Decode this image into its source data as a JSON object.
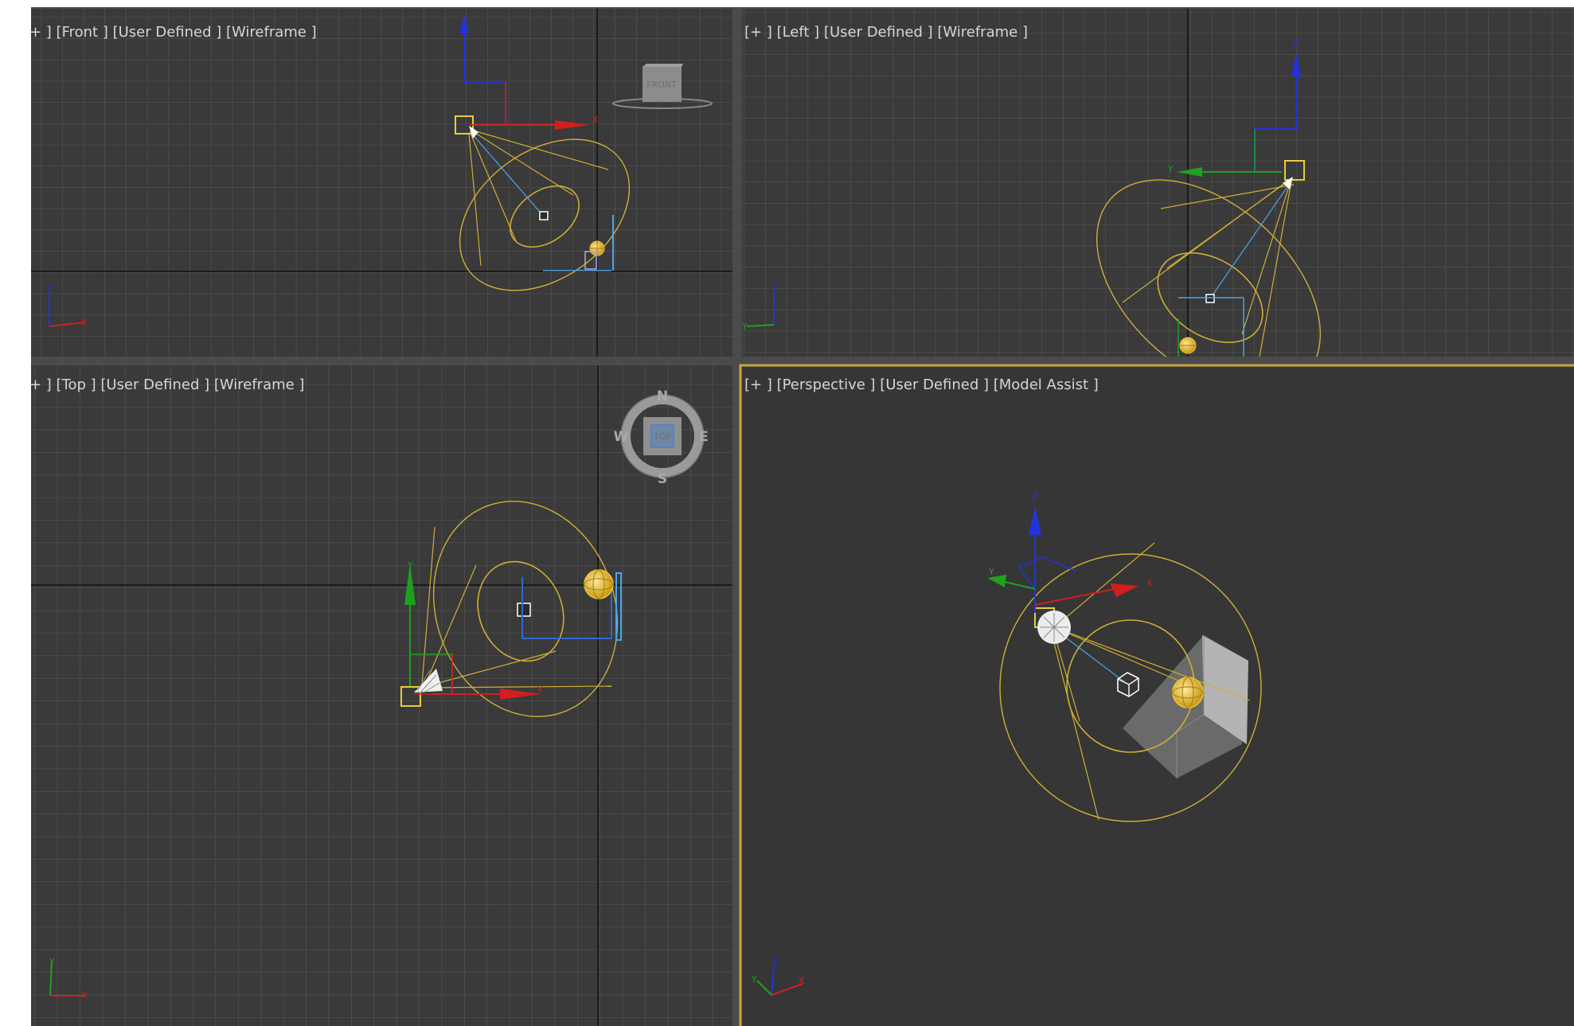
{
  "colors": {
    "viewport_bg": "#3a3a3a",
    "perspective_bg": "#363636",
    "grid": "#5a5a5a",
    "grid_major": "#111111",
    "divider": "#4b4b4b",
    "active_border": "#c7a640",
    "light": "#cfae36",
    "axis_x": "#d21e1e",
    "axis_y": "#1fa01f",
    "axis_z": "#2233dd",
    "target": "#ffffff",
    "target_line": "#4aa6e8",
    "wall": "#c8c8c8"
  },
  "viewports": {
    "front": {
      "label": "+ ] [Front ] [User Defined ] [Wireframe ]",
      "viewcube_label": "FRONT",
      "axis_tripod": [
        "Z",
        "X"
      ]
    },
    "left": {
      "label": "[+ ] [Left ] [User Defined ] [Wireframe ]",
      "gizmo_labels": [
        "Z",
        "Y"
      ],
      "axis_tripod": [
        "Z",
        "Y"
      ]
    },
    "top": {
      "label": "+ ] [Top ] [User Defined ] [Wireframe ]",
      "viewcube_label": "TOP",
      "compass": {
        "n": "N",
        "s": "S",
        "e": "E",
        "w": "W"
      },
      "gizmo_labels": [
        "Y",
        "X"
      ],
      "axis_tripod": [
        "Y",
        "X"
      ]
    },
    "perspective": {
      "label": "[+ ] [Perspective ] [User Defined ] [Model Assist ]",
      "gizmo_labels": [
        "Z",
        "Y",
        "X"
      ],
      "axis_tripod": [
        "Z",
        "Y",
        "X"
      ],
      "active": true
    }
  }
}
